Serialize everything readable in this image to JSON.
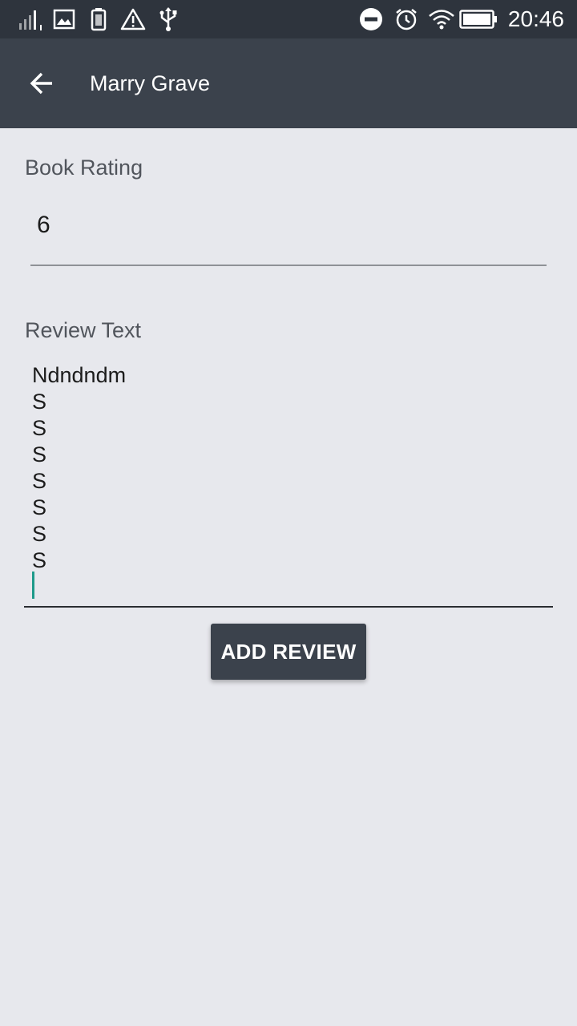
{
  "status_bar": {
    "time": "20:46",
    "icons": [
      "signal-icon",
      "image-notification-icon",
      "battery-saver-icon",
      "warning-icon",
      "usb-icon",
      "do-not-disturb-icon",
      "alarm-icon",
      "wifi-icon",
      "battery-icon"
    ]
  },
  "app_bar": {
    "title": "Marry Grave",
    "back_icon": "arrow-back-icon"
  },
  "form": {
    "rating_label": "Book Rating",
    "rating_value": "6",
    "review_label": "Review Text",
    "review_value": "Ndndndm\nS\nS\nS\nS\nS\nS\nS\n",
    "caret_color": "#1e9a8a"
  },
  "actions": {
    "add_review_label": "ADD REVIEW"
  },
  "colors": {
    "status_bar": "#2e343d",
    "app_bar": "#3b424c",
    "background": "#e7e8ed",
    "button": "#3b424c"
  }
}
